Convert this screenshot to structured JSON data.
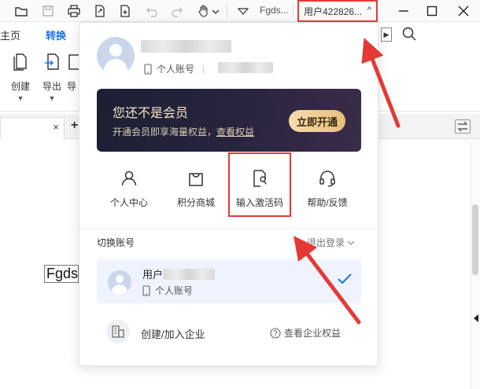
{
  "titlebar": {
    "filename": "Fgds...",
    "user_label": "用户422826...",
    "user_chevron": "^",
    "icons": [
      "folder-icon",
      "save-icon",
      "print-icon",
      "export-icon",
      "new-icon",
      "undo-icon",
      "redo-icon",
      "hand-tool-icon",
      "chevron-down-icon"
    ]
  },
  "menu": {
    "tabs": [
      "主页",
      "转换"
    ],
    "active_tab": "转换"
  },
  "ribbon": {
    "items": [
      {
        "label": "创建",
        "icon": "create-icon"
      },
      {
        "label": "导出",
        "icon": "export-icon"
      },
      {
        "label": "导",
        "icon": "more-icon"
      }
    ]
  },
  "doc_tab": {
    "close": "×",
    "new": "+"
  },
  "document": {
    "text": "Fgdsg"
  },
  "popup": {
    "account_type": "个人账号",
    "vip": {
      "title": "您还不是会员",
      "subtitle": "开通会员即享海量权益，",
      "link": "查看权益",
      "button": "立即开通"
    },
    "grid": [
      {
        "label": "个人中心",
        "icon": "user-icon"
      },
      {
        "label": "积分商城",
        "icon": "shopping-bag-icon"
      },
      {
        "label": "输入激活码",
        "icon": "activation-code-icon"
      },
      {
        "label": "帮助/反馈",
        "icon": "headset-icon"
      }
    ],
    "switch_account": "切换账号",
    "logout": "退出登录",
    "account_row": {
      "name": "用户",
      "type": "个人账号"
    },
    "enterprise": {
      "label": "创建/加入企业",
      "rights": "查看企业权益"
    }
  },
  "colors": {
    "accent": "#1a73e8",
    "annotation": "#e53935",
    "vip_button": "#e8bd7c",
    "vip_card": "#1b1f33"
  }
}
